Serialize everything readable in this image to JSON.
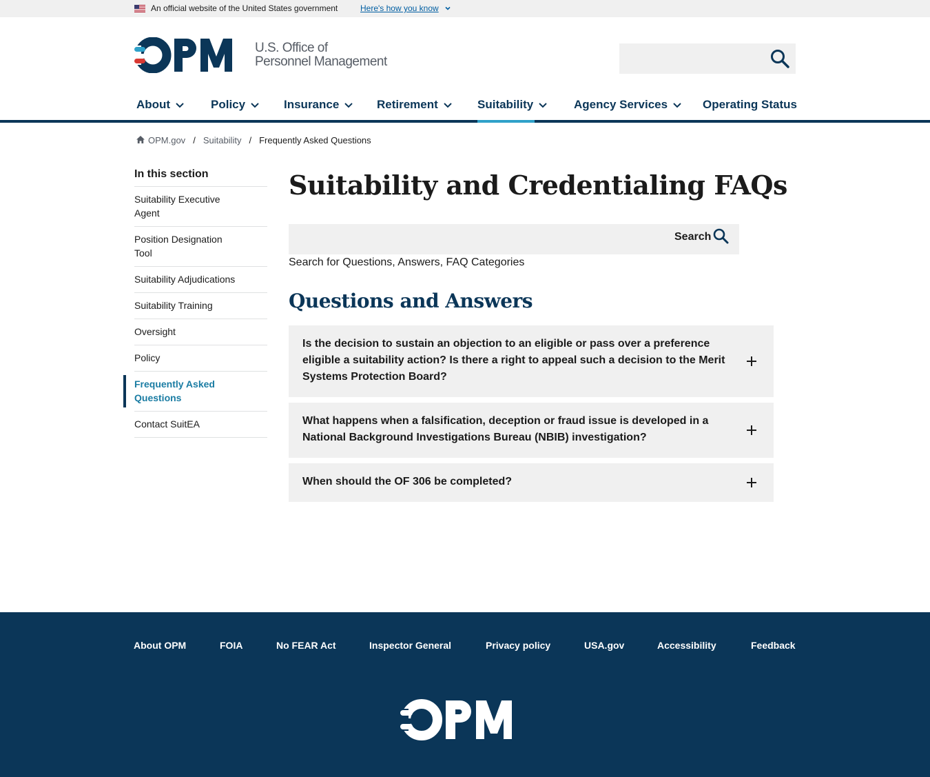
{
  "gov_banner": {
    "official_text": "An official website of the United States government",
    "how_you_know": "Here's how you know"
  },
  "header": {
    "logo_line1": "U.S. Office of",
    "logo_line2": "Personnel Management",
    "search_placeholder": ""
  },
  "nav": {
    "items": [
      {
        "label": "About",
        "has_dropdown": true
      },
      {
        "label": "Policy",
        "has_dropdown": true
      },
      {
        "label": "Insurance",
        "has_dropdown": true
      },
      {
        "label": "Retirement",
        "has_dropdown": true
      },
      {
        "label": "Suitability",
        "has_dropdown": true,
        "active": true
      },
      {
        "label": "Agency Services",
        "has_dropdown": true
      },
      {
        "label": "Operating Status",
        "has_dropdown": false
      }
    ]
  },
  "breadcrumb": {
    "items": [
      "OPM.gov",
      "Suitability",
      "Frequently Asked Questions"
    ],
    "separator": "/"
  },
  "sidenav": {
    "title": "In this section",
    "items": [
      {
        "label": "Suitability Executive Agent"
      },
      {
        "label": "Position Designation Tool"
      },
      {
        "label": "Suitability Adjudications"
      },
      {
        "label": "Suitability Training"
      },
      {
        "label": "Oversight"
      },
      {
        "label": "Policy"
      },
      {
        "label": "Frequently Asked Questions",
        "active": true
      },
      {
        "label": "Contact SuitEA"
      }
    ]
  },
  "main": {
    "title": "Suitability and Credentialing FAQs",
    "search_button": "Search",
    "search_hint": "Search for Questions, Answers, FAQ Categories",
    "qa_heading": "Questions and Answers",
    "questions": [
      "Is the decision to sustain an objection to an eligible or pass over a preference eligible a suitability action? Is there a right to appeal such a decision to the Merit Systems Protection Board?",
      "What happens when a falsification, deception or fraud issue is developed in a National Background Investigations Bureau (NBIB) investigation?",
      "When should the OF 306 be completed?"
    ]
  },
  "footer": {
    "links": [
      "About OPM",
      "FOIA",
      "No FEAR Act",
      "Inspector General",
      "Privacy policy",
      "USA.gov",
      "Accessibility",
      "Feedback"
    ]
  },
  "colors": {
    "brand_navy": "#0b3658",
    "accent_blue": "#2fa1c9",
    "link_blue": "#005ea2",
    "logo_red": "#d83933",
    "gray_bg": "#f0f0f0"
  },
  "icons": [
    "us-flag-icon",
    "chevron-down-icon",
    "search-icon",
    "home-icon",
    "plus-icon",
    "opm-logo"
  ]
}
